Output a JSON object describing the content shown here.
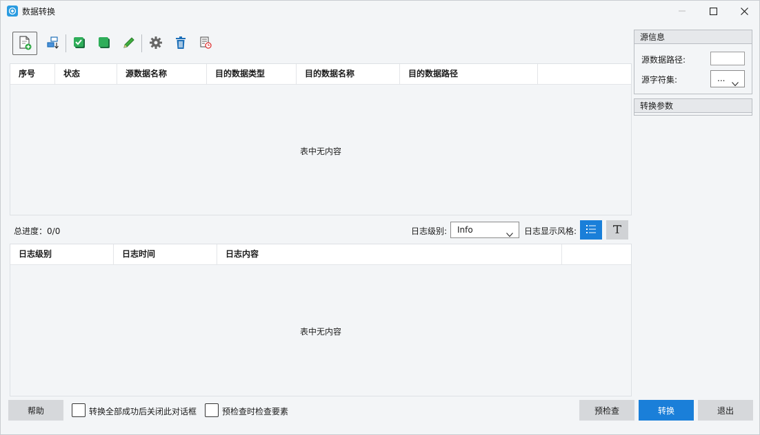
{
  "window": {
    "title": "数据转换",
    "controls": [
      "minimize",
      "maximize",
      "close"
    ]
  },
  "toolbar": {
    "buttons": [
      {
        "id": "add-file",
        "icon": "add-file-icon"
      },
      {
        "id": "sort",
        "icon": "sort-down-icon"
      },
      {
        "id": "check-all",
        "icon": "check-all-icon"
      },
      {
        "id": "select-all",
        "icon": "select-all-icon"
      },
      {
        "id": "edit",
        "icon": "pencil-icon"
      },
      {
        "id": "settings",
        "icon": "gear-icon"
      },
      {
        "id": "delete",
        "icon": "trash-icon"
      },
      {
        "id": "history",
        "icon": "history-icon"
      }
    ]
  },
  "task_table": {
    "columns": [
      "序号",
      "状态",
      "源数据名称",
      "目的数据类型",
      "目的数据名称",
      "目的数据路径"
    ],
    "empty_text": "表中无内容"
  },
  "progress": {
    "label": "总进度：",
    "value": "0/0"
  },
  "log_controls": {
    "level_label": "日志级别:",
    "level_value": "Info",
    "style_label": "日志显示风格:"
  },
  "log_table": {
    "columns": [
      "日志级别",
      "日志时间",
      "日志内容"
    ],
    "empty_text": "表中无内容"
  },
  "source_info": {
    "title": "源信息",
    "path_label": "源数据路径:",
    "path_value": "",
    "charset_label": "源字符集:",
    "charset_value": "..."
  },
  "convert_params": {
    "title": "转换参数"
  },
  "footer": {
    "help_label": "帮助",
    "close_on_success_label": "转换全部成功后关闭此对话框",
    "close_on_success_checked": false,
    "precheck_elements_label": "预检查时检查要素",
    "precheck_elements_checked": false,
    "precheck_label": "预检查",
    "convert_label": "转换",
    "exit_label": "退出"
  },
  "colors": {
    "primary": "#1a7fd9",
    "background": "#f3f5f7",
    "button": "#d6d8db"
  }
}
